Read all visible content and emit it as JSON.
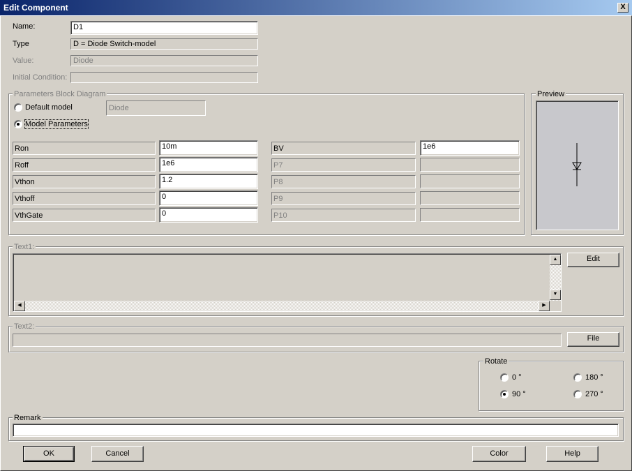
{
  "window": {
    "title": "Edit Component",
    "close_symbol": "X"
  },
  "fields": {
    "name_label": "Name:",
    "name_value": "D1",
    "type_label": "Type",
    "type_value": "D = Diode Switch-model",
    "value_label": "Value:",
    "value_value": "Diode",
    "initial_condition_label": "Initial Condition:",
    "initial_condition_value": ""
  },
  "params_block": {
    "title": "Parameters Block Diagram",
    "default_model_label": "Default model",
    "default_model_value": "Diode",
    "model_params_label": "Model Parameters",
    "selected": "model_parameters",
    "left": [
      {
        "label": "Ron",
        "value": "10m",
        "enabled": true
      },
      {
        "label": "Roff",
        "value": "1e6",
        "enabled": true
      },
      {
        "label": "Vthon",
        "value": "1.2",
        "enabled": true
      },
      {
        "label": "Vthoff",
        "value": "0",
        "enabled": true
      },
      {
        "label": "VthGate",
        "value": "0",
        "enabled": true
      }
    ],
    "right": [
      {
        "label": "BV",
        "value": "1e6",
        "enabled": true
      },
      {
        "label": "P7",
        "value": "",
        "enabled": false
      },
      {
        "label": "P8",
        "value": "",
        "enabled": false
      },
      {
        "label": "P9",
        "value": "",
        "enabled": false
      },
      {
        "label": "P10",
        "value": "",
        "enabled": false
      }
    ]
  },
  "preview": {
    "title": "Preview",
    "symbol": "diode-symbol"
  },
  "text1": {
    "label": "Text1:",
    "value": "",
    "edit_button": "Edit"
  },
  "text2": {
    "label": "Text2:",
    "value": "",
    "file_button": "File"
  },
  "rotate": {
    "title": "Rotate",
    "options": [
      "0 °",
      "90 °",
      "180 °",
      "270 °"
    ],
    "selected": "90 °"
  },
  "remark": {
    "label": "Remark",
    "value": ""
  },
  "buttons": {
    "ok": "OK",
    "cancel": "Cancel",
    "color": "Color",
    "help": "Help"
  },
  "colors": {
    "titlebar_start": "#0a246a",
    "titlebar_end": "#a6caf0",
    "face": "#d4d0c8",
    "disabled_text": "#808080"
  }
}
